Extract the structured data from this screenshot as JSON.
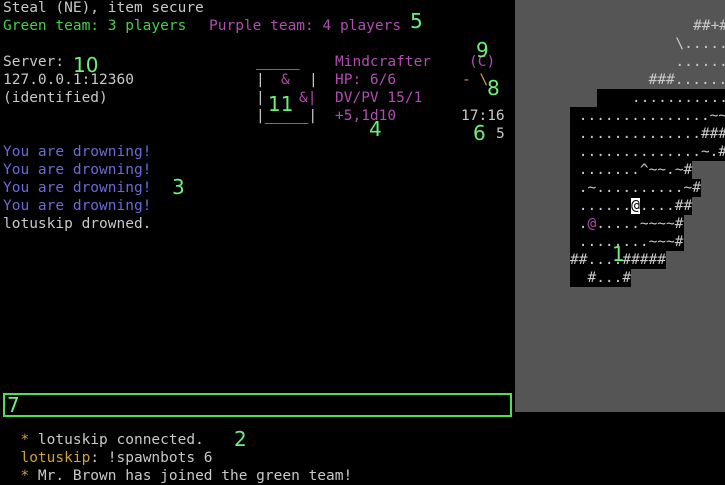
{
  "status_line": "Steal (NE), item secure",
  "teams": {
    "green": "Green team: 3 players",
    "purple": "Purple team: 4 players"
  },
  "server": {
    "label": "Server:",
    "address": "127.0.0.1:12360",
    "status": "(identified)"
  },
  "character": {
    "name": "Mindcrafter",
    "hp": "HP: 6/6",
    "dvpv": "DV/PV 15/1",
    "attack": "+5,1d10",
    "weapon_slot": "(C)",
    "weapon_glyph": "- \\",
    "time": "17:16",
    "turns": "5"
  },
  "portrait": {
    "top": "_____",
    "row1_left": "|",
    "row1_glyph": "&",
    "row1_right": "|",
    "row2_left": "|",
    "row2_glyph": "&|",
    "bottom": "|_____|"
  },
  "messages": [
    "You are drowning!",
    "You are drowning!",
    "You are drowning!",
    "You are drowning!",
    "lotuskip drowned."
  ],
  "chat": {
    "lines": [
      {
        "bullet": "*",
        "text": " lotuskip connected."
      },
      {
        "name": "lotuskip",
        "text": ": !spawnbots 6"
      },
      {
        "bullet": "*",
        "text": " Mr. Brown has joined the green team!"
      }
    ]
  },
  "callouts": [
    "1",
    "2",
    "3",
    "4",
    "5",
    "6",
    "7",
    "8",
    "9",
    "10",
    "11"
  ],
  "map_rows": [
    "         #...",
    "       ##+###.....",
    "      \\.........",
    "      .........",
    "     ###.........",
    "    ..............~",
    " ...............~~",
    " ..............####",
    " ..............~.#",
    " .......^~~.~#",
    " .~..........~#",
    " ......@....##",
    " .@.....~~~~#",
    " ........~~~#",
    "##....#####",
    "  #...#"
  ],
  "colors": {
    "green": "#47cf47",
    "purple": "#b24cb2",
    "callout": "#6cf07a",
    "map_bg": "#555555"
  }
}
